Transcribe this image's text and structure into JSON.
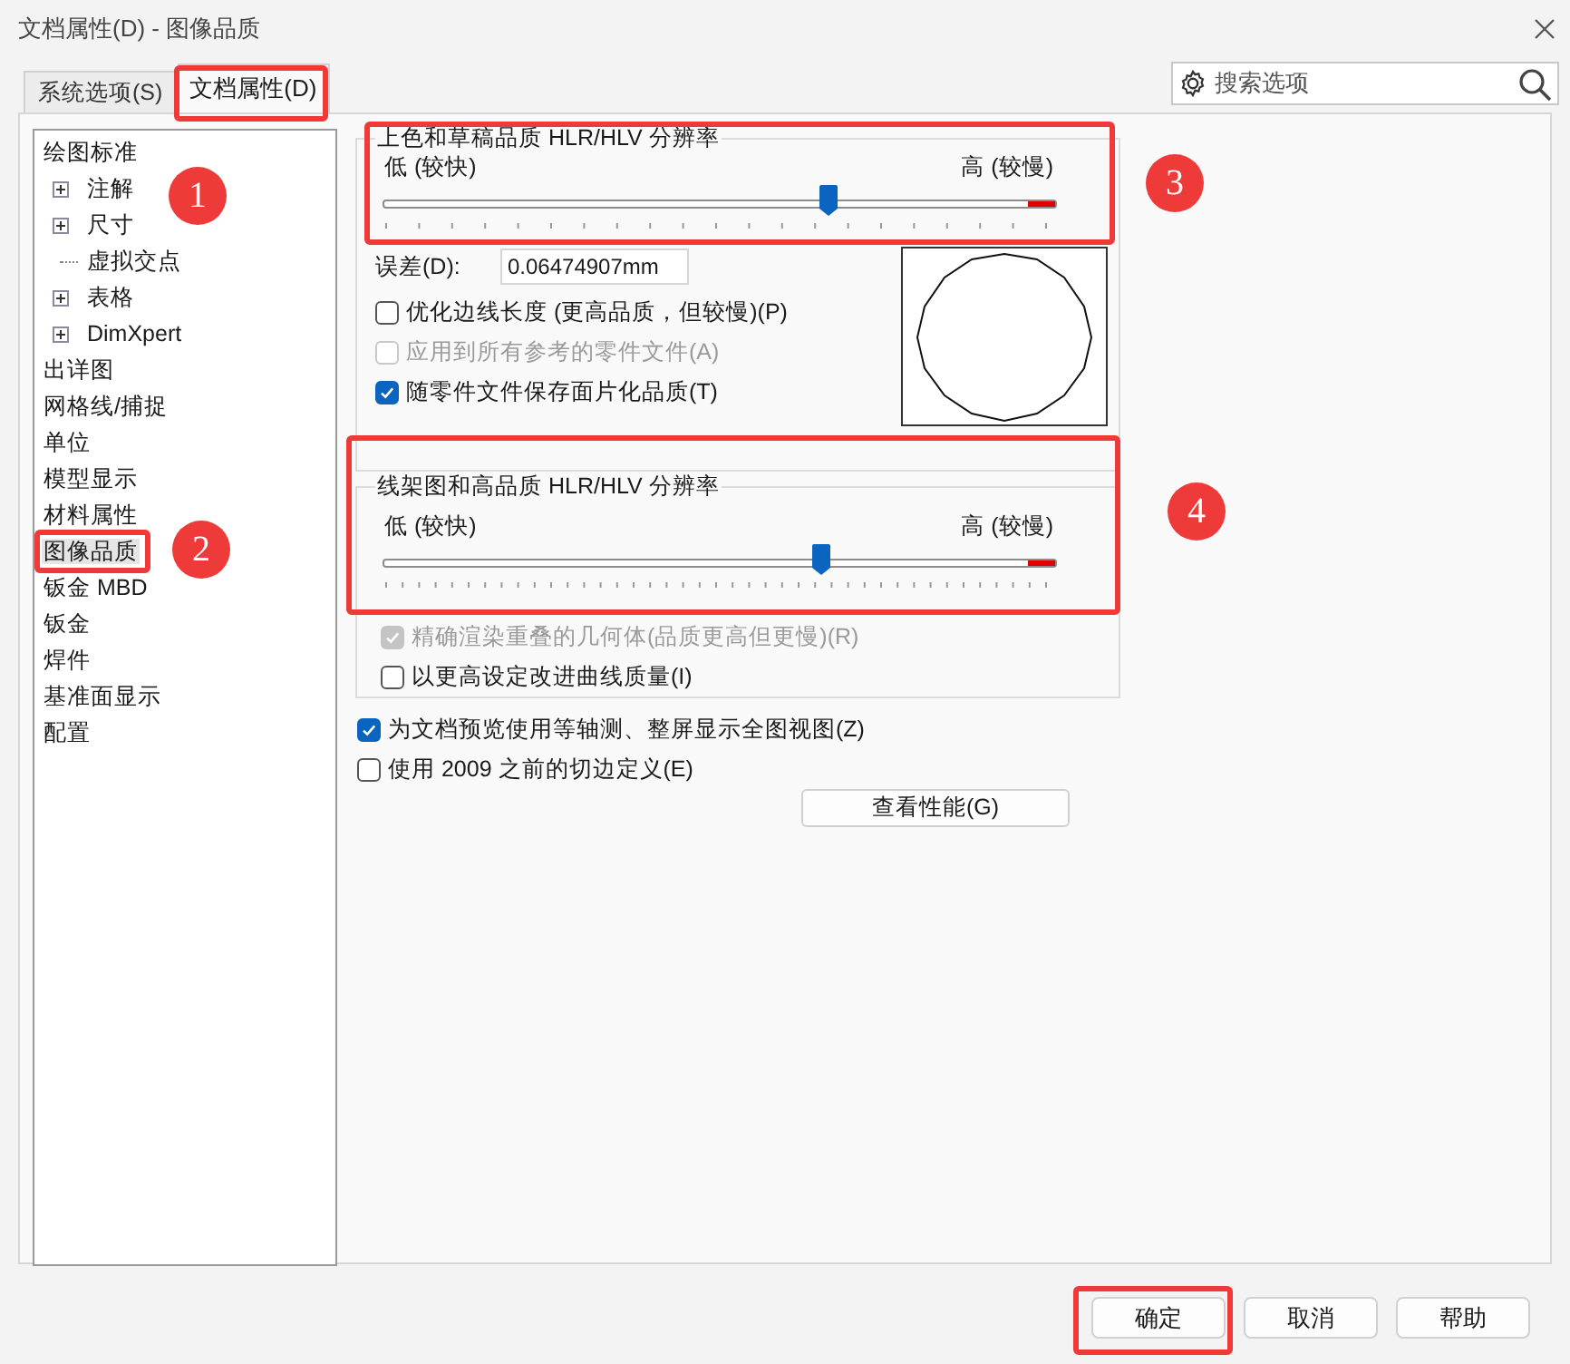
{
  "window": {
    "title": "文档属性(D) - 图像品质"
  },
  "tabs": [
    {
      "label": "系统选项(S)",
      "selected": false
    },
    {
      "label": "文档属性(D)",
      "selected": true
    }
  ],
  "search": {
    "placeholder": "搜索选项"
  },
  "tree": [
    {
      "label": "绘图标准",
      "selected": false,
      "children": [
        {
          "label": "注解",
          "expanded": false,
          "selected": false
        },
        {
          "label": "尺寸",
          "expanded": false,
          "selected": false
        },
        {
          "label": "虚拟交点",
          "selected": false
        },
        {
          "label": "表格",
          "expanded": false,
          "selected": false
        },
        {
          "label": "DimXpert",
          "expanded": false,
          "selected": false
        }
      ]
    },
    {
      "label": "出详图",
      "selected": false
    },
    {
      "label": "网格线/捕捉",
      "selected": false
    },
    {
      "label": "单位",
      "selected": false
    },
    {
      "label": "模型显示",
      "selected": false
    },
    {
      "label": "材料属性",
      "selected": false
    },
    {
      "label": "图像品质",
      "selected": true
    },
    {
      "label": "钣金 MBD",
      "selected": false
    },
    {
      "label": "钣金",
      "selected": false
    },
    {
      "label": "焊件",
      "selected": false
    },
    {
      "label": "基准面显示",
      "selected": false
    },
    {
      "label": "配置",
      "selected": false
    }
  ],
  "shaded_quality": {
    "title": "上色和草稿品质 HLR/HLV 分辨率",
    "low_label": "低 (较快)",
    "high_label": "高 (较慢)",
    "level": 0.66,
    "error_label": "误差(D):",
    "error_value": "0.06474907mm",
    "options": [
      {
        "label": "优化边线长度 (更高品质，但较慢)(P)",
        "checked": false,
        "disabled": false
      },
      {
        "label": "应用到所有参考的零件文件(A)",
        "checked": false,
        "disabled": true
      },
      {
        "label": "随零件文件保存面片化品质(T)",
        "checked": true,
        "disabled": false
      }
    ]
  },
  "wireframe_quality": {
    "title": "线架图和高品质 HLR/HLV 分辨率",
    "low_label": "低 (较快)",
    "high_label": "高 (较慢)",
    "level": 0.65,
    "options": [
      {
        "label": "精确渲染重叠的几何体(品质更高但更慢)(R)",
        "checked": true,
        "disabled": true
      },
      {
        "label": "以更高设定改进曲线质量(I)",
        "checked": false,
        "disabled": false
      }
    ]
  },
  "options": [
    {
      "label": "为文档预览使用等轴测、整屏显示全图视图(Z)",
      "checked": true,
      "disabled": false
    },
    {
      "label": "使用 2009 之前的切边定义(E)",
      "checked": false,
      "disabled": false
    }
  ],
  "performance_button": "查看性能(G)",
  "footer_buttons": [
    "确定",
    "取消",
    "帮助"
  ],
  "annotations": [
    "1",
    "2",
    "3",
    "4"
  ]
}
